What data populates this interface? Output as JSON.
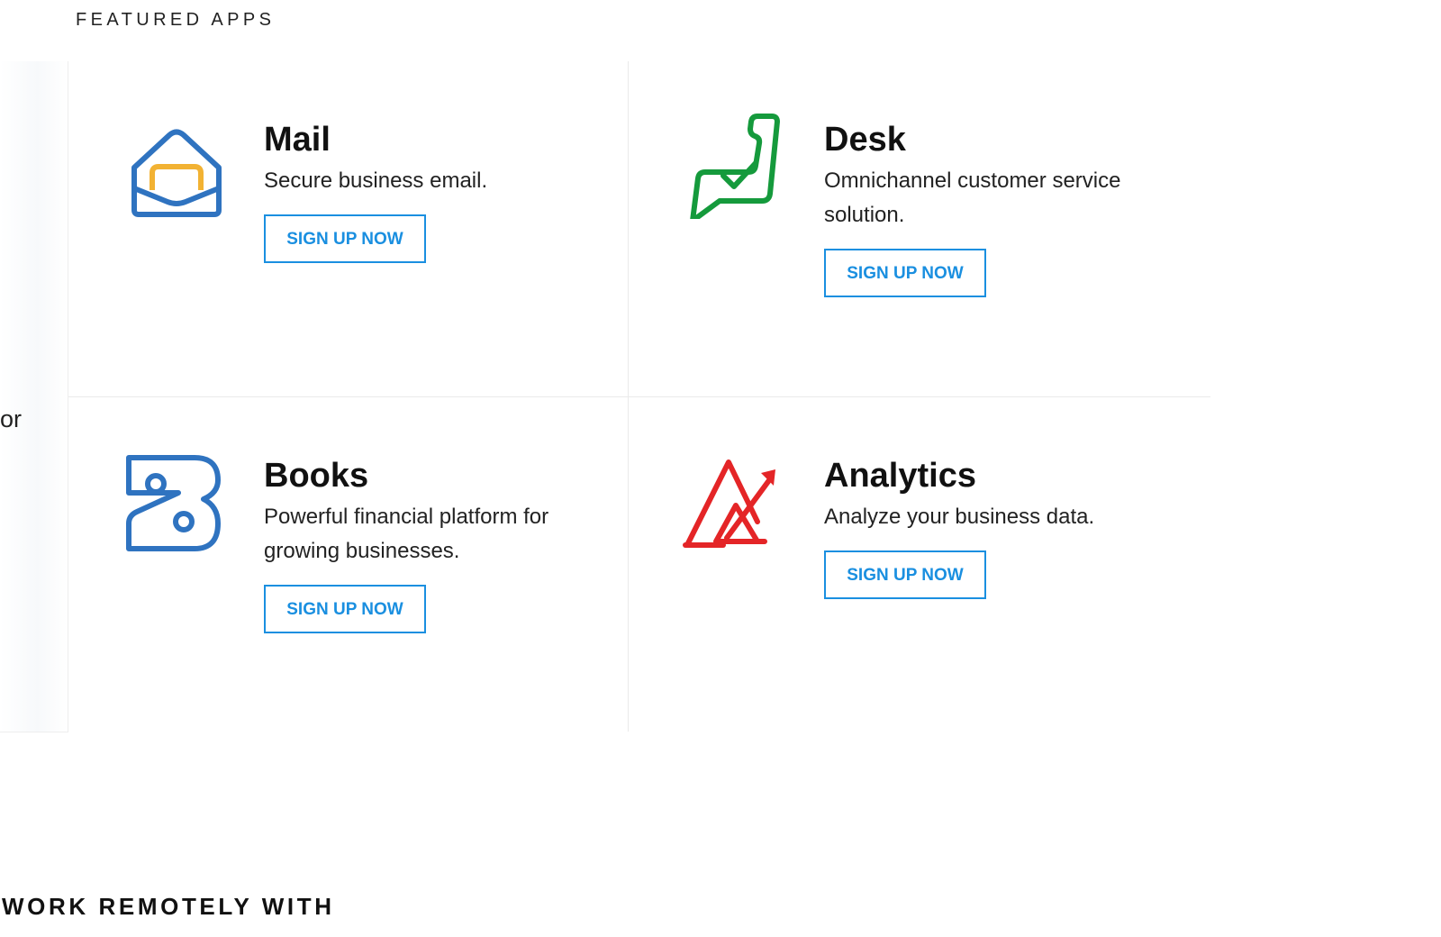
{
  "featured": {
    "heading": "FEATURED APPS"
  },
  "left_panel": {
    "text": "or"
  },
  "apps": [
    {
      "name": "Mail",
      "description": "Secure business email.",
      "button_label": "SIGN UP NOW",
      "icon": "mail-icon",
      "color": "#2f73c0",
      "accent": "#f2b233"
    },
    {
      "name": "Desk",
      "description": "Omnichannel customer service solution.",
      "button_label": "SIGN UP NOW",
      "icon": "desk-icon",
      "color": "#159a3c"
    },
    {
      "name": "Books",
      "description": "Powerful financial platform for growing businesses.",
      "button_label": "SIGN UP NOW",
      "icon": "books-icon",
      "color": "#2f73c0"
    },
    {
      "name": "Analytics",
      "description": "Analyze your business data.",
      "button_label": "SIGN UP NOW",
      "icon": "analytics-icon",
      "color": "#e42527"
    }
  ],
  "remote": {
    "heading": "WORK REMOTELY WITH"
  },
  "colors": {
    "button_accent": "#1a8fe0",
    "divider": "#eaeaea"
  }
}
